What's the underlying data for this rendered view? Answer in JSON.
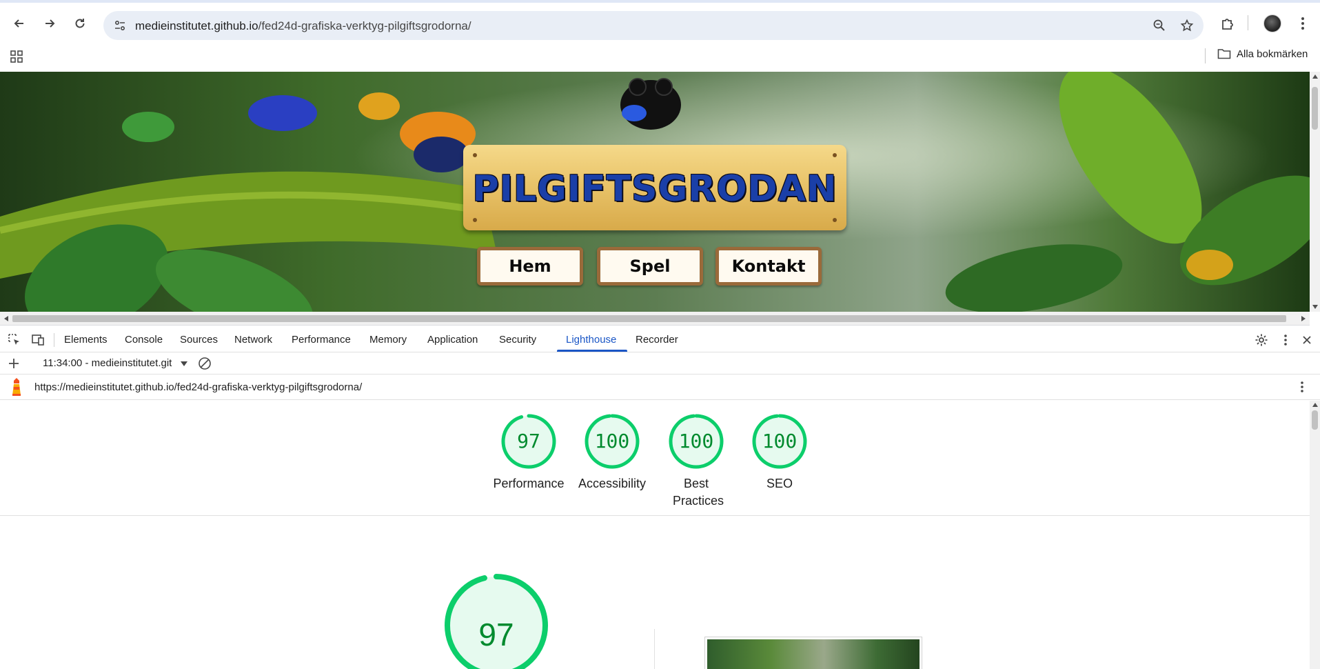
{
  "browser": {
    "url_host": "medieinstitutet.github.io",
    "url_path": "/fed24d-grafiska-verktyg-pilgiftsgrodorna/",
    "bookmarks_all_label": "Alla bokmärken"
  },
  "website": {
    "title": "PILGIFTSGRODAN",
    "nav": [
      {
        "label": "Hem"
      },
      {
        "label": "Spel"
      },
      {
        "label": "Kontakt"
      }
    ]
  },
  "devtools": {
    "tabs": [
      "Elements",
      "Console",
      "Sources",
      "Network",
      "Performance",
      "Memory",
      "Application",
      "Security",
      "Lighthouse",
      "Recorder"
    ],
    "active_tab": "Lighthouse",
    "report_select": "11:34:00 - medieinstitutet.git",
    "report_url": "https://medieinstitutet.github.io/fed24d-grafiska-verktyg-pilgiftsgrodorna/"
  },
  "lighthouse": {
    "scores": [
      {
        "label": "Performance",
        "value": "97"
      },
      {
        "label": "Accessibility",
        "value": "100"
      },
      {
        "label": "Best Practices",
        "value": "100"
      },
      {
        "label": "SEO",
        "value": "100"
      }
    ],
    "main_score": "97",
    "colors": {
      "pass": "#0cce6b",
      "pass_text": "#008a2e",
      "pass_bg": "#e6faef"
    }
  }
}
